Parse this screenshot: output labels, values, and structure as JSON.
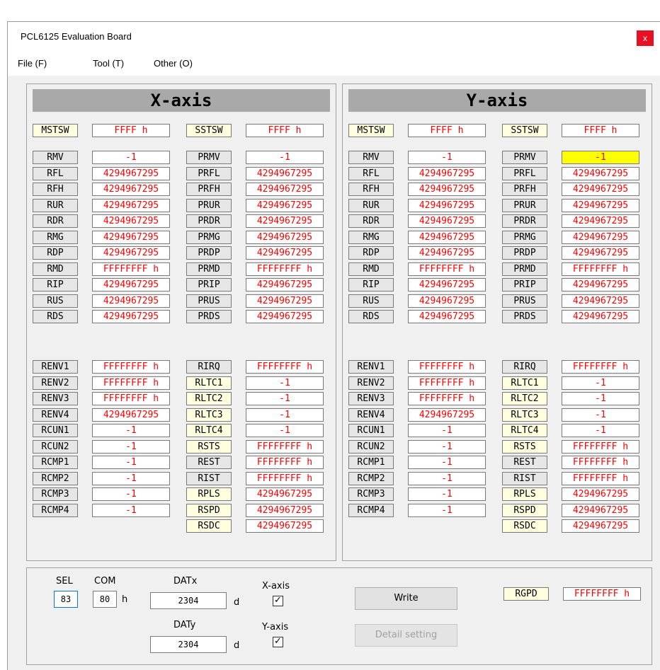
{
  "window": {
    "title": "PCL6125 Evaluation Board",
    "close_glyph": "x"
  },
  "menu": [
    "File (F)",
    "Tool (T)",
    "Other (O)"
  ],
  "axes": [
    {
      "title": "X-axis",
      "status": [
        {
          "label": "MSTSW",
          "value": "FFFF h"
        },
        {
          "label": "SSTSW",
          "value": "FFFF h"
        }
      ],
      "registers": [
        {
          "label": "RMV",
          "value": "-1"
        },
        {
          "label": "RFL",
          "value": "4294967295"
        },
        {
          "label": "RFH",
          "value": "4294967295"
        },
        {
          "label": "RUR",
          "value": "4294967295"
        },
        {
          "label": "RDR",
          "value": "4294967295"
        },
        {
          "label": "RMG",
          "value": "4294967295"
        },
        {
          "label": "RDP",
          "value": "4294967295"
        },
        {
          "label": "RMD",
          "value": "FFFFFFFF h"
        },
        {
          "label": "RIP",
          "value": "4294967295"
        },
        {
          "label": "RUS",
          "value": "4294967295"
        },
        {
          "label": "RDS",
          "value": "4294967295"
        }
      ],
      "preregisters": [
        {
          "label": "PRMV",
          "value": "-1"
        },
        {
          "label": "PRFL",
          "value": "4294967295"
        },
        {
          "label": "PRFH",
          "value": "4294967295"
        },
        {
          "label": "PRUR",
          "value": "4294967295"
        },
        {
          "label": "PRDR",
          "value": "4294967295"
        },
        {
          "label": "PRMG",
          "value": "4294967295"
        },
        {
          "label": "PRDP",
          "value": "4294967295"
        },
        {
          "label": "PRMD",
          "value": "FFFFFFFF h"
        },
        {
          "label": "PRIP",
          "value": "4294967295"
        },
        {
          "label": "PRUS",
          "value": "4294967295"
        },
        {
          "label": "PRDS",
          "value": "4294967295"
        }
      ],
      "env": [
        {
          "label": "RENV1",
          "value": "FFFFFFFF h"
        },
        {
          "label": "RENV2",
          "value": "FFFFFFFF h"
        },
        {
          "label": "RENV3",
          "value": "FFFFFFFF h"
        },
        {
          "label": "RENV4",
          "value": "4294967295"
        },
        {
          "label": "RCUN1",
          "value": "-1"
        },
        {
          "label": "RCUN2",
          "value": "-1"
        },
        {
          "label": "RCMP1",
          "value": "-1"
        },
        {
          "label": "RCMP2",
          "value": "-1"
        },
        {
          "label": "RCMP3",
          "value": "-1"
        },
        {
          "label": "RCMP4",
          "value": "-1"
        }
      ],
      "irq": [
        {
          "label": "RIRQ",
          "value": "FFFFFFFF h",
          "yellow": false
        },
        {
          "label": "RLTC1",
          "value": "-1",
          "yellow": true
        },
        {
          "label": "RLTC2",
          "value": "-1",
          "yellow": true
        },
        {
          "label": "RLTC3",
          "value": "-1",
          "yellow": true
        },
        {
          "label": "RLTC4",
          "value": "-1",
          "yellow": true
        },
        {
          "label": "RSTS",
          "value": "FFFFFFFF h",
          "yellow": true
        },
        {
          "label": "REST",
          "value": "FFFFFFFF h",
          "yellow": false
        },
        {
          "label": "RIST",
          "value": "FFFFFFFF h",
          "yellow": false
        },
        {
          "label": "RPLS",
          "value": "4294967295",
          "yellow": true
        },
        {
          "label": "RSPD",
          "value": "4294967295",
          "yellow": true
        },
        {
          "label": "RSDC",
          "value": "4294967295",
          "yellow": true
        }
      ]
    },
    {
      "title": "Y-axis",
      "status": [
        {
          "label": "MSTSW",
          "value": "FFFF h"
        },
        {
          "label": "SSTSW",
          "value": "FFFF h"
        }
      ],
      "registers": [
        {
          "label": "RMV",
          "value": "-1"
        },
        {
          "label": "RFL",
          "value": "4294967295"
        },
        {
          "label": "RFH",
          "value": "4294967295"
        },
        {
          "label": "RUR",
          "value": "4294967295"
        },
        {
          "label": "RDR",
          "value": "4294967295"
        },
        {
          "label": "RMG",
          "value": "4294967295"
        },
        {
          "label": "RDP",
          "value": "4294967295"
        },
        {
          "label": "RMD",
          "value": "FFFFFFFF h"
        },
        {
          "label": "RIP",
          "value": "4294967295"
        },
        {
          "label": "RUS",
          "value": "4294967295"
        },
        {
          "label": "RDS",
          "value": "4294967295"
        }
      ],
      "preregisters": [
        {
          "label": "PRMV",
          "value": "-1",
          "highlight": true
        },
        {
          "label": "PRFL",
          "value": "4294967295"
        },
        {
          "label": "PRFH",
          "value": "4294967295"
        },
        {
          "label": "PRUR",
          "value": "4294967295"
        },
        {
          "label": "PRDR",
          "value": "4294967295"
        },
        {
          "label": "PRMG",
          "value": "4294967295"
        },
        {
          "label": "PRDP",
          "value": "4294967295"
        },
        {
          "label": "PRMD",
          "value": "FFFFFFFF h"
        },
        {
          "label": "PRIP",
          "value": "4294967295"
        },
        {
          "label": "PRUS",
          "value": "4294967295"
        },
        {
          "label": "PRDS",
          "value": "4294967295"
        }
      ],
      "env": [
        {
          "label": "RENV1",
          "value": "FFFFFFFF h"
        },
        {
          "label": "RENV2",
          "value": "FFFFFFFF h"
        },
        {
          "label": "RENV3",
          "value": "FFFFFFFF h"
        },
        {
          "label": "RENV4",
          "value": "4294967295"
        },
        {
          "label": "RCUN1",
          "value": "-1"
        },
        {
          "label": "RCUN2",
          "value": "-1"
        },
        {
          "label": "RCMP1",
          "value": "-1"
        },
        {
          "label": "RCMP2",
          "value": "-1"
        },
        {
          "label": "RCMP3",
          "value": "-1"
        },
        {
          "label": "RCMP4",
          "value": "-1"
        }
      ],
      "irq": [
        {
          "label": "RIRQ",
          "value": "FFFFFFFF h",
          "yellow": false
        },
        {
          "label": "RLTC1",
          "value": "-1",
          "yellow": true
        },
        {
          "label": "RLTC2",
          "value": "-1",
          "yellow": true
        },
        {
          "label": "RLTC3",
          "value": "-1",
          "yellow": true
        },
        {
          "label": "RLTC4",
          "value": "-1",
          "yellow": true
        },
        {
          "label": "RSTS",
          "value": "FFFFFFFF h",
          "yellow": true
        },
        {
          "label": "REST",
          "value": "FFFFFFFF h",
          "yellow": false
        },
        {
          "label": "RIST",
          "value": "FFFFFFFF h",
          "yellow": false
        },
        {
          "label": "RPLS",
          "value": "4294967295",
          "yellow": true
        },
        {
          "label": "RSPD",
          "value": "4294967295",
          "yellow": true
        },
        {
          "label": "RSDC",
          "value": "4294967295",
          "yellow": true
        }
      ]
    }
  ],
  "controls": {
    "sel_label": "SEL",
    "sel_value": "83",
    "com_label": "COM",
    "com_value": "80",
    "com_unit": "h",
    "datx_label": "DATx",
    "datx_value": "2304",
    "datx_unit": "d",
    "daty_label": "DATy",
    "daty_value": "2304",
    "daty_unit": "d",
    "xaxis_check_label": "X-axis",
    "xaxis_checked": true,
    "yaxis_check_label": "Y-axis",
    "yaxis_checked": true,
    "write_label": "Write",
    "detail_label": "Detail setting",
    "rgpd_label": "RGPD",
    "rgpd_value": "FFFFFFFF h",
    "check_glyph": "✓"
  },
  "colors": {
    "value_text": "#ff0000",
    "label_bg": "#e6e6e6",
    "yellow_label_bg": "#ffffe0",
    "highlight": "#ffff00",
    "header_bg": "#a9a9a9"
  }
}
